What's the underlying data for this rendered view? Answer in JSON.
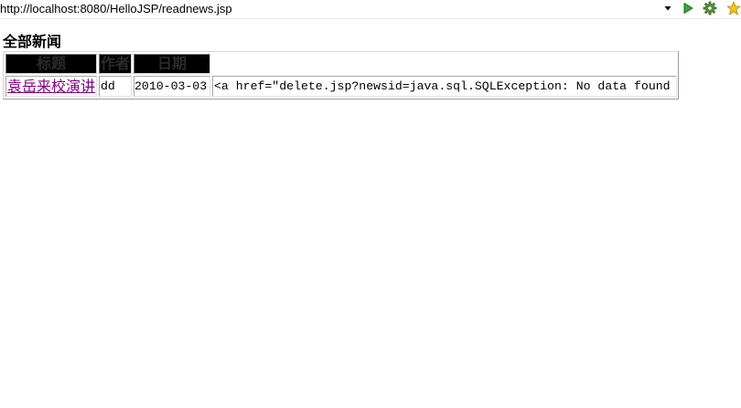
{
  "browser": {
    "url": "http://localhost:8080/HelloJSP/readnews.jsp",
    "icons": {
      "dropdown": "chevron-down-icon",
      "go": "play-icon",
      "settings": "gear-icon",
      "favorite": "star-icon"
    }
  },
  "page": {
    "heading": "全部新闻",
    "table": {
      "headers": [
        "标题",
        "作者",
        "日期"
      ],
      "rows": [
        {
          "title": "袁岳来校演讲",
          "author": "dd",
          "date": "2010-03-03",
          "extra": "<a href=\"delete.jsp?newsid=java.sql.SQLException: No data found"
        }
      ]
    }
  },
  "colors": {
    "header_bg": "#000000",
    "header_text": "#2b2b2b",
    "link_visited": "#800080",
    "go_icon": "#3aa23a"
  }
}
